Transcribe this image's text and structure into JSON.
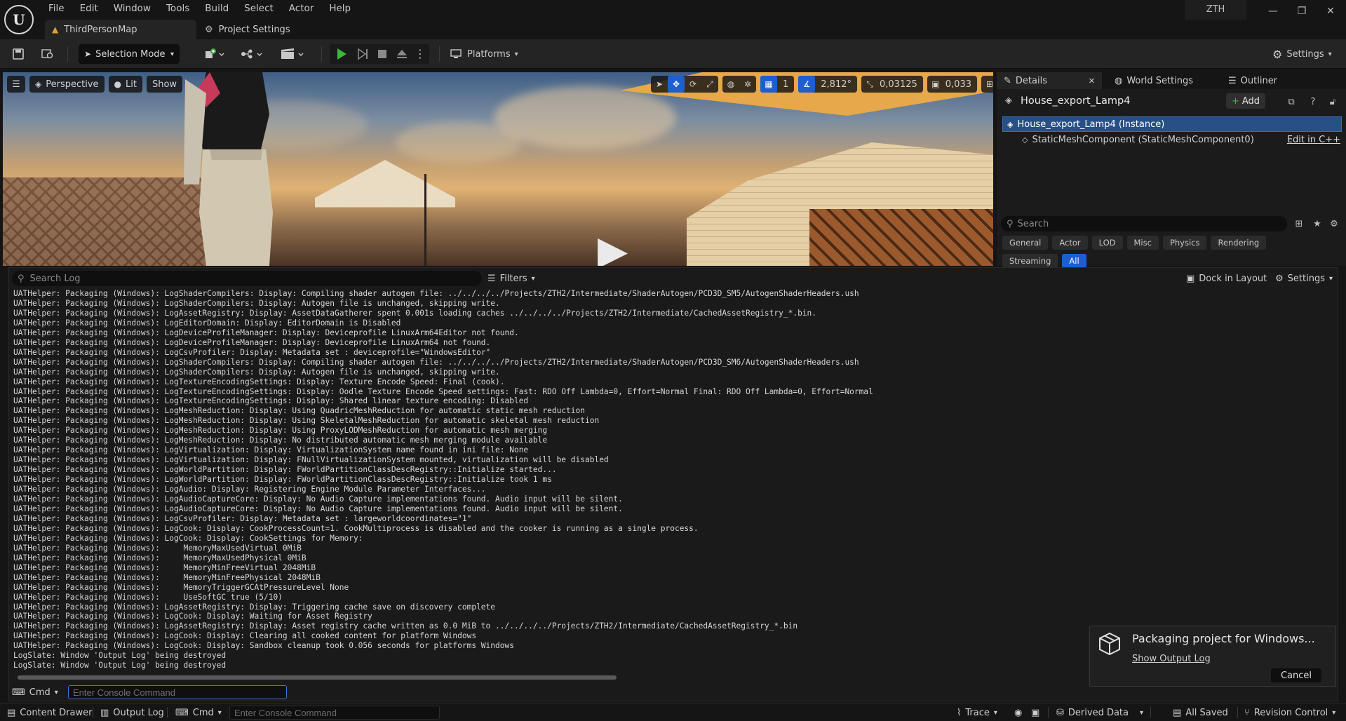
{
  "app": {
    "logo": "U",
    "user": "ZTH",
    "menu": [
      "File",
      "Edit",
      "Window",
      "Tools",
      "Build",
      "Select",
      "Actor",
      "Help"
    ],
    "tabs": [
      {
        "label": "ThirdPersonMap",
        "icon": "level-icon"
      },
      {
        "label": "Project Settings",
        "icon": "gear-icon"
      }
    ]
  },
  "toolbar": {
    "selection_mode": "Selection Mode",
    "platforms": "Platforms",
    "settings": "Settings"
  },
  "viewport": {
    "perspective": "Perspective",
    "lit": "Lit",
    "show": "Show",
    "grid_value": "1",
    "angle_value": "2,812°",
    "scale_value": "0,03125",
    "camera_speed": "0,033"
  },
  "details": {
    "tabs": [
      "Details",
      "World Settings",
      "Outliner"
    ],
    "actor_name": "House_export_Lamp4",
    "add_label": "Add",
    "components": [
      {
        "label": "House_export_Lamp4 (Instance)",
        "selected": true
      },
      {
        "label": "StaticMeshComponent (StaticMeshComponent0)",
        "selected": false
      }
    ],
    "edit_cpp": "Edit in C++",
    "search_placeholder": "Search",
    "filters": [
      "General",
      "Actor",
      "LOD",
      "Misc",
      "Physics",
      "Rendering",
      "Streaming",
      "All"
    ],
    "active_filter": "All"
  },
  "output_log": {
    "search_placeholder": "Search Log",
    "filters_label": "Filters",
    "dock_label": "Dock in Layout",
    "settings_label": "Settings",
    "cmd_label": "Cmd",
    "cmd_placeholder": "Enter Console Command",
    "lines": [
      "UATHelper: Packaging (Windows): LogShaderCompilers: Display: Compiling shader autogen file: ../../../../Projects/ZTH2/Intermediate/ShaderAutogen/PCD3D_SM5/AutogenShaderHeaders.ush",
      "UATHelper: Packaging (Windows): LogShaderCompilers: Display: Autogen file is unchanged, skipping write.",
      "UATHelper: Packaging (Windows): LogAssetRegistry: Display: AssetDataGatherer spent 0.001s loading caches ../../../../Projects/ZTH2/Intermediate/CachedAssetRegistry_*.bin.",
      "UATHelper: Packaging (Windows): LogEditorDomain: Display: EditorDomain is Disabled",
      "UATHelper: Packaging (Windows): LogDeviceProfileManager: Display: Deviceprofile LinuxArm64Editor not found.",
      "UATHelper: Packaging (Windows): LogDeviceProfileManager: Display: Deviceprofile LinuxArm64 not found.",
      "UATHelper: Packaging (Windows): LogCsvProfiler: Display: Metadata set : deviceprofile=\"WindowsEditor\"",
      "UATHelper: Packaging (Windows): LogShaderCompilers: Display: Compiling shader autogen file: ../../../../Projects/ZTH2/Intermediate/ShaderAutogen/PCD3D_SM6/AutogenShaderHeaders.ush",
      "UATHelper: Packaging (Windows): LogShaderCompilers: Display: Autogen file is unchanged, skipping write.",
      "UATHelper: Packaging (Windows): LogTextureEncodingSettings: Display: Texture Encode Speed: Final (cook).",
      "UATHelper: Packaging (Windows): LogTextureEncodingSettings: Display: Oodle Texture Encode Speed settings: Fast: RDO Off Lambda=0, Effort=Normal Final: RDO Off Lambda=0, Effort=Normal",
      "UATHelper: Packaging (Windows): LogTextureEncodingSettings: Display: Shared linear texture encoding: Disabled",
      "UATHelper: Packaging (Windows): LogMeshReduction: Display: Using QuadricMeshReduction for automatic static mesh reduction",
      "UATHelper: Packaging (Windows): LogMeshReduction: Display: Using SkeletalMeshReduction for automatic skeletal mesh reduction",
      "UATHelper: Packaging (Windows): LogMeshReduction: Display: Using ProxyLODMeshReduction for automatic mesh merging",
      "UATHelper: Packaging (Windows): LogMeshReduction: Display: No distributed automatic mesh merging module available",
      "UATHelper: Packaging (Windows): LogVirtualization: Display: VirtualizationSystem name found in ini file: None",
      "UATHelper: Packaging (Windows): LogVirtualization: Display: FNullVirtualizationSystem mounted, virtualization will be disabled",
      "UATHelper: Packaging (Windows): LogWorldPartition: Display: FWorldPartitionClassDescRegistry::Initialize started...",
      "UATHelper: Packaging (Windows): LogWorldPartition: Display: FWorldPartitionClassDescRegistry::Initialize took 1 ms",
      "UATHelper: Packaging (Windows): LogAudio: Display: Registering Engine Module Parameter Interfaces...",
      "UATHelper: Packaging (Windows): LogAudioCaptureCore: Display: No Audio Capture implementations found. Audio input will be silent.",
      "UATHelper: Packaging (Windows): LogAudioCaptureCore: Display: No Audio Capture implementations found. Audio input will be silent.",
      "UATHelper: Packaging (Windows): LogCsvProfiler: Display: Metadata set : largeworldcoordinates=\"1\"",
      "UATHelper: Packaging (Windows): LogCook: Display: CookProcessCount=1. CookMultiprocess is disabled and the cooker is running as a single process.",
      "UATHelper: Packaging (Windows): LogCook: Display: CookSettings for Memory:",
      "UATHelper: Packaging (Windows):     MemoryMaxUsedVirtual 0MiB",
      "UATHelper: Packaging (Windows):     MemoryMaxUsedPhysical 0MiB",
      "UATHelper: Packaging (Windows):     MemoryMinFreeVirtual 2048MiB",
      "UATHelper: Packaging (Windows):     MemoryMinFreePhysical 2048MiB",
      "UATHelper: Packaging (Windows):     MemoryTriggerGCAtPressureLevel None",
      "UATHelper: Packaging (Windows):     UseSoftGC true (5/10)",
      "UATHelper: Packaging (Windows): LogAssetRegistry: Display: Triggering cache save on discovery complete",
      "UATHelper: Packaging (Windows): LogCook: Display: Waiting for Asset Registry",
      "UATHelper: Packaging (Windows): LogAssetRegistry: Display: Asset registry cache written as 0.0 MiB to ../../../../Projects/ZTH2/Intermediate/CachedAssetRegistry_*.bin",
      "UATHelper: Packaging (Windows): LogCook: Display: Clearing all cooked content for platform Windows",
      "UATHelper: Packaging (Windows): LogCook: Display: Sandbox cleanup took 0.056 seconds for platforms Windows",
      "LogSlate: Window 'Output Log' being destroyed",
      "LogSlate: Window 'Output Log' being destroyed"
    ]
  },
  "toast": {
    "title": "Packaging project for Windows...",
    "link": "Show Output Log",
    "cancel": "Cancel"
  },
  "statusbar": {
    "content_drawer": "Content Drawer",
    "output_log": "Output Log",
    "cmd": "Cmd",
    "cmd_placeholder": "Enter Console Command",
    "trace": "Trace",
    "derived_data": "Derived Data",
    "all_saved": "All Saved",
    "revision_control": "Revision Control"
  }
}
